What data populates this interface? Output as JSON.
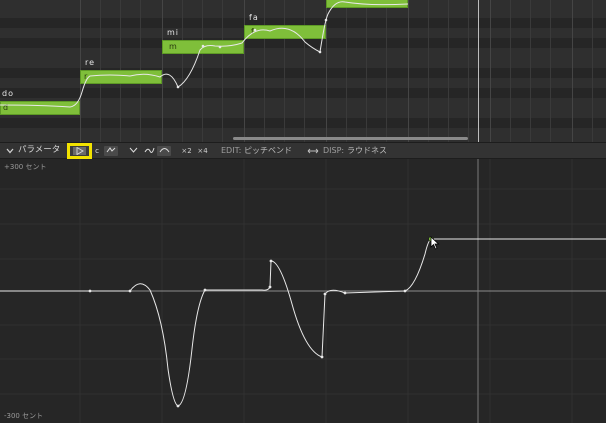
{
  "piano_roll": {
    "notes": [
      {
        "lyric": "do",
        "phoneme": "d"
      },
      {
        "lyric": "re",
        "phoneme": "r"
      },
      {
        "lyric": "mi",
        "phoneme": "m"
      },
      {
        "lyric": "fa",
        "phoneme": "f"
      },
      {
        "lyric": "",
        "phoneme": ""
      }
    ]
  },
  "toolbar": {
    "collapse_icon": "chevron-down-icon",
    "panel_title": "パラメータ",
    "play_icon": "play-icon",
    "btn_c_label": "c",
    "btn_x2_label": "×2",
    "btn_x4_label": "×4",
    "edit_label": "EDIT:",
    "edit_value": "ピッチベンド",
    "swap_icon": "double-arrow-icon",
    "disp_label": "DISP:",
    "disp_value": "ラウドネス"
  },
  "graph": {
    "top_label": "+300 セント",
    "bottom_label": "-300 セント"
  },
  "colors": {
    "note_fill": "#7fbf3a",
    "highlight": "#f2e200",
    "curve": "#e8e8e8"
  }
}
